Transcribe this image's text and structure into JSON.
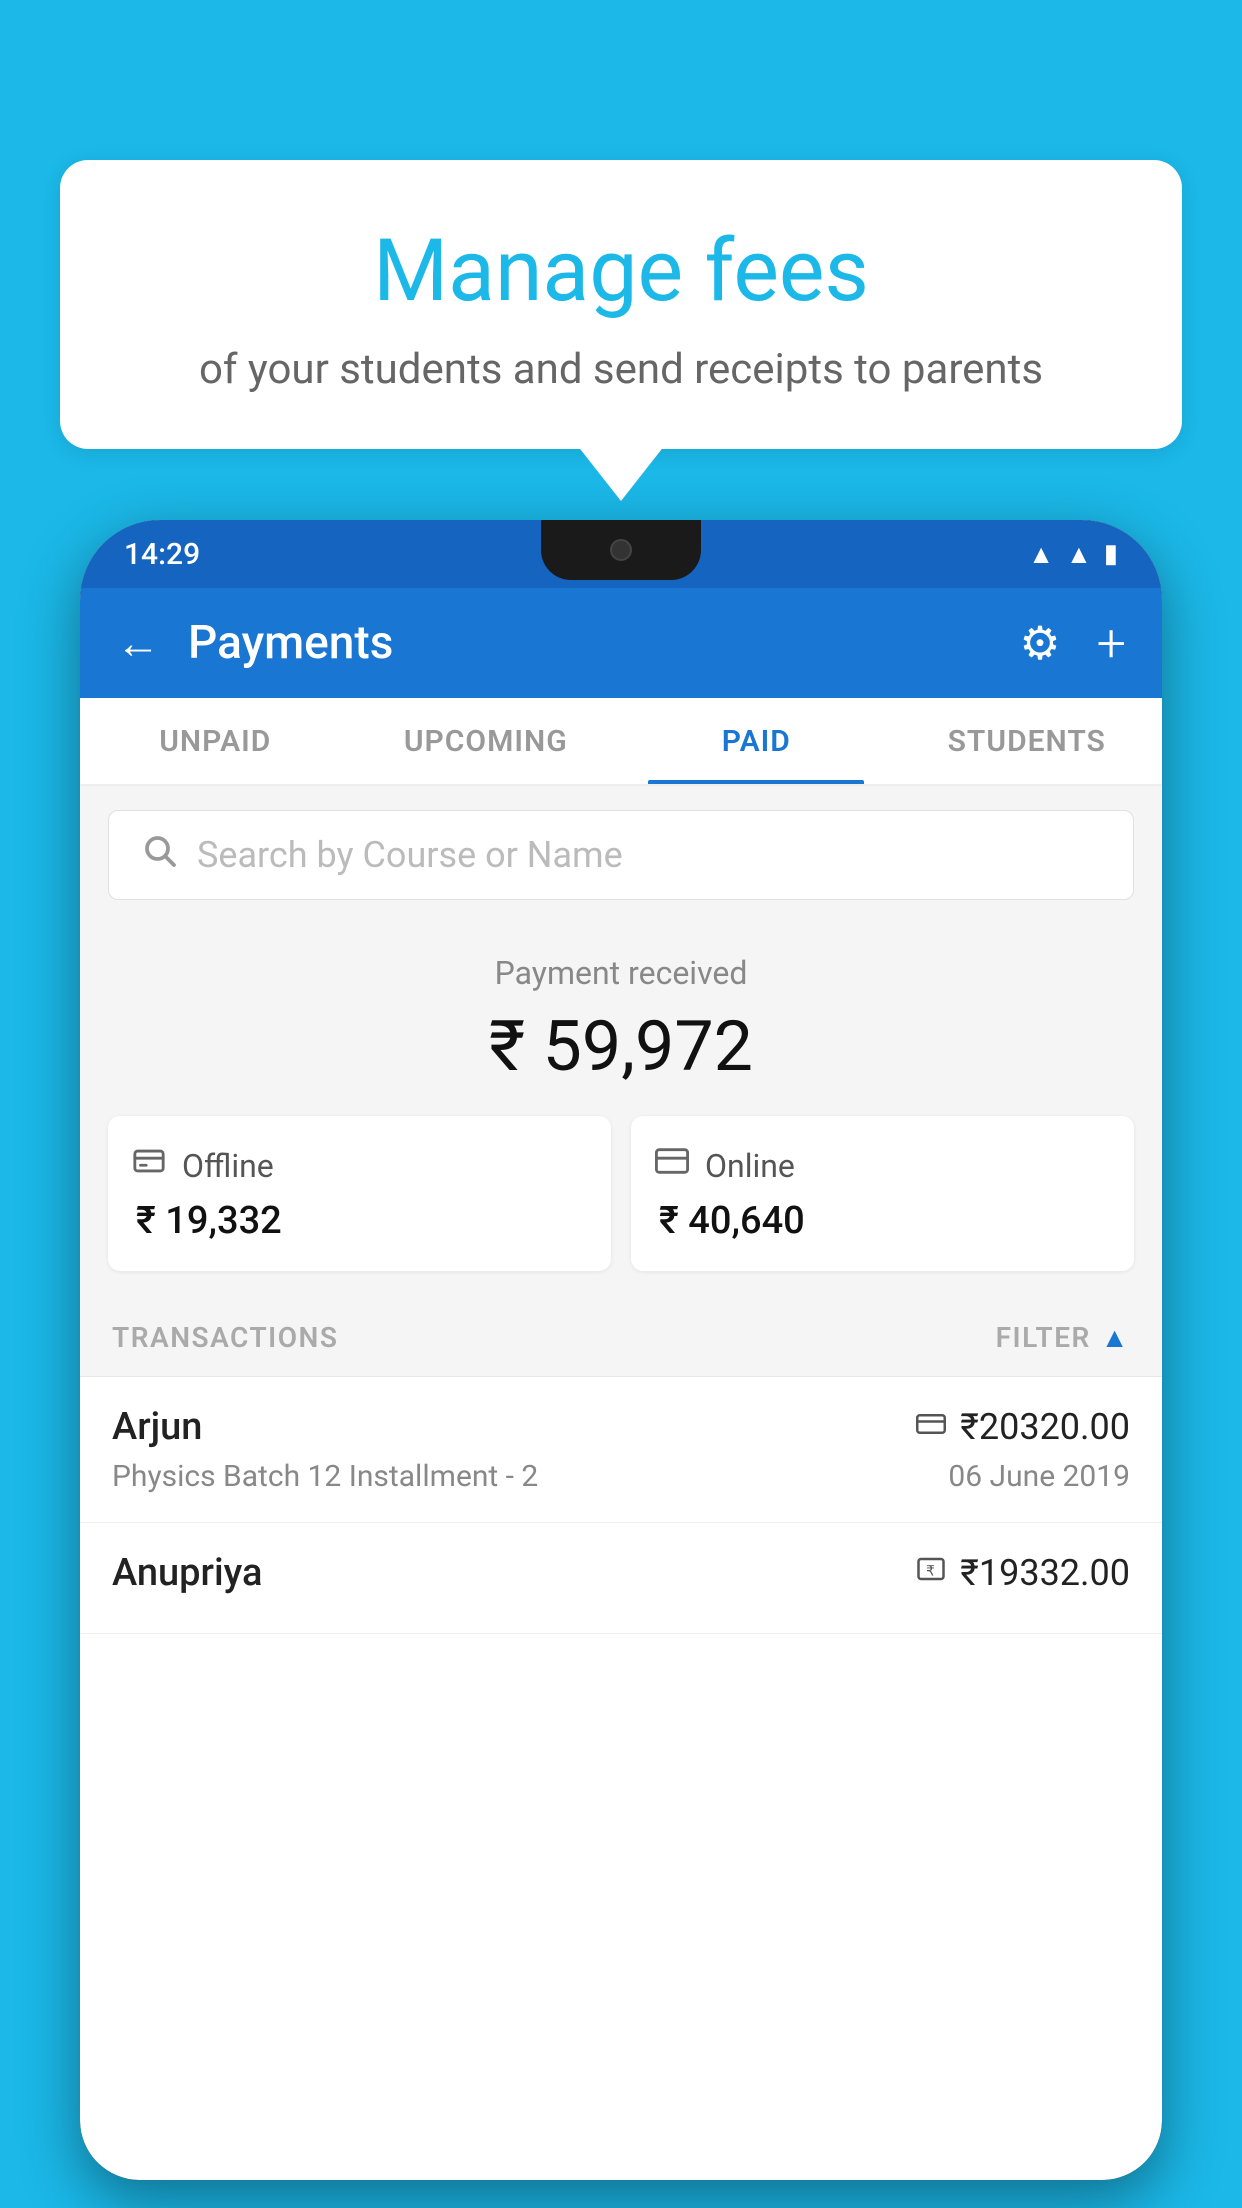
{
  "background_color": "#1BB8E8",
  "bubble": {
    "title": "Manage fees",
    "subtitle": "of your students and send receipts to parents"
  },
  "status_bar": {
    "time": "14:29",
    "wifi_icon": "▼",
    "signal_icon": "▲",
    "battery_icon": "▮"
  },
  "header": {
    "back_label": "←",
    "title": "Payments",
    "gear_icon": "⚙",
    "plus_icon": "+"
  },
  "tabs": [
    {
      "label": "UNPAID",
      "active": false
    },
    {
      "label": "UPCOMING",
      "active": false
    },
    {
      "label": "PAID",
      "active": true
    },
    {
      "label": "STUDENTS",
      "active": false
    }
  ],
  "search": {
    "placeholder": "Search by Course or Name"
  },
  "payment_summary": {
    "label": "Payment received",
    "total": "₹ 59,972",
    "offline": {
      "label": "Offline",
      "amount": "₹ 19,332"
    },
    "online": {
      "label": "Online",
      "amount": "₹ 40,640"
    }
  },
  "transactions": {
    "section_label": "TRANSACTIONS",
    "filter_label": "FILTER",
    "items": [
      {
        "name": "Arjun",
        "course": "Physics Batch 12 Installment - 2",
        "amount": "₹20320.00",
        "date": "06 June 2019",
        "payment_method": "card"
      },
      {
        "name": "Anupriya",
        "course": "",
        "amount": "₹19332.00",
        "date": "",
        "payment_method": "rupee"
      }
    ]
  }
}
